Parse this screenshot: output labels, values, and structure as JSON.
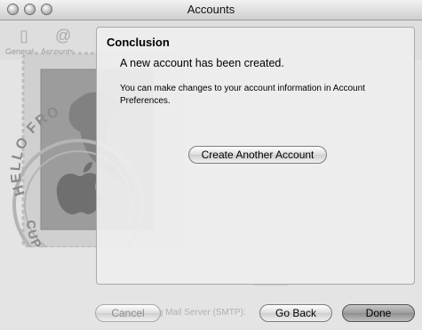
{
  "window": {
    "title": "Accounts"
  },
  "toolbar_ghost": {
    "general_label": "General",
    "accounts_label": "Accounts"
  },
  "background_ghost": {
    "smtp_text": "ing Mail Server (SMTP):"
  },
  "stamp": {
    "top_text": "HELLO FRO",
    "bottom_text": "CUPERTINO CA"
  },
  "panel": {
    "heading": "Conclusion",
    "message": "A new account has been created.",
    "note": "You can make changes to your account information in Account Preferences.",
    "create_button": "Create Another Account"
  },
  "buttons": {
    "cancel": "Cancel",
    "back": "Go Back",
    "done": "Done"
  }
}
